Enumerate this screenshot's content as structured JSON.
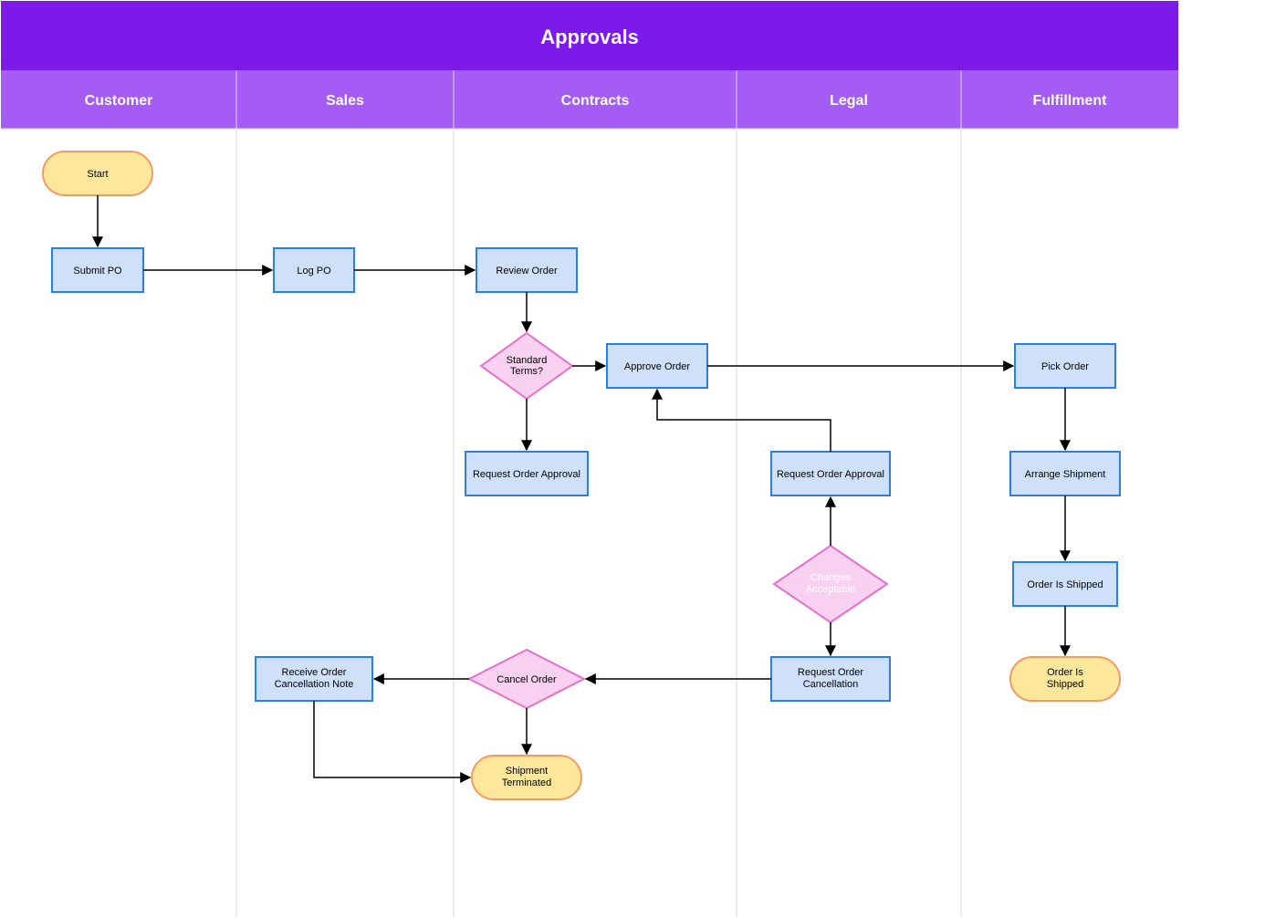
{
  "diagram": {
    "type": "swimlane-flowchart",
    "title": "Approvals",
    "lanes": [
      {
        "id": "customer",
        "label": "Customer"
      },
      {
        "id": "sales",
        "label": "Sales"
      },
      {
        "id": "contracts",
        "label": "Contracts"
      },
      {
        "id": "legal",
        "label": "Legal"
      },
      {
        "id": "fulfillment",
        "label": "Fulfillment"
      }
    ],
    "nodes": {
      "start": {
        "lane": "customer",
        "type": "terminator",
        "label": "Start"
      },
      "submit_po": {
        "lane": "customer",
        "type": "process",
        "label": "Submit PO"
      },
      "log_po": {
        "lane": "sales",
        "type": "process",
        "label": "Log PO"
      },
      "review_order": {
        "lane": "contracts",
        "type": "process",
        "label": "Review Order"
      },
      "standard_terms": {
        "lane": "contracts",
        "type": "decision",
        "label": "Standard Terms?"
      },
      "request_approval_contracts": {
        "lane": "contracts",
        "type": "process",
        "label": "Request Order Approval"
      },
      "approve_order": {
        "lane": "contracts",
        "type": "process",
        "label": "Approve Order"
      },
      "request_approval_legal": {
        "lane": "legal",
        "type": "process",
        "label": "Request Order Approval"
      },
      "changes_acceptable": {
        "lane": "legal",
        "type": "decision",
        "label": "Changes Acceptable"
      },
      "request_cancellation_legal": {
        "lane": "legal",
        "type": "process",
        "label": "Request Order Cancellation"
      },
      "cancel_order": {
        "lane": "contracts",
        "type": "decision",
        "label": "Cancel Order"
      },
      "receive_cancel_note": {
        "lane": "sales",
        "type": "process",
        "label": "Receive Order Cancellation Note"
      },
      "shipment_terminated": {
        "lane": "contracts",
        "type": "terminator",
        "label": "Shipment Terminated"
      },
      "pick_order": {
        "lane": "fulfillment",
        "type": "process",
        "label": "Pick Order"
      },
      "arrange_shipment": {
        "lane": "fulfillment",
        "type": "process",
        "label": "Arrange Shipment"
      },
      "order_shipped": {
        "lane": "fulfillment",
        "type": "process",
        "label": "Order Is Shipped"
      },
      "order_shipped_end": {
        "lane": "fulfillment",
        "type": "terminator",
        "label": "Order Is Shipped"
      }
    },
    "edges": [
      [
        "start",
        "submit_po"
      ],
      [
        "submit_po",
        "log_po"
      ],
      [
        "log_po",
        "review_order"
      ],
      [
        "review_order",
        "standard_terms"
      ],
      [
        "standard_terms",
        "approve_order"
      ],
      [
        "standard_terms",
        "request_approval_contracts"
      ],
      [
        "approve_order",
        "pick_order"
      ],
      [
        "request_approval_legal",
        "approve_order"
      ],
      [
        "changes_acceptable",
        "request_approval_legal"
      ],
      [
        "changes_acceptable",
        "request_cancellation_legal"
      ],
      [
        "request_cancellation_legal",
        "cancel_order"
      ],
      [
        "cancel_order",
        "receive_cancel_note"
      ],
      [
        "cancel_order",
        "shipment_terminated"
      ],
      [
        "receive_cancel_note",
        "shipment_terminated"
      ],
      [
        "pick_order",
        "arrange_shipment"
      ],
      [
        "arrange_shipment",
        "order_shipped"
      ],
      [
        "order_shipped",
        "order_shipped_end"
      ]
    ]
  },
  "colors": {
    "header_bg": "#7c1aea",
    "lane_bg": "#a45cf4",
    "lane_divider": "#d9d9d9",
    "process_fill": "#cfe0fb",
    "process_stroke": "#2b7de9",
    "decision_fill": "#f7d1ef",
    "decision_stroke": "#e66fc9",
    "terminator_fill": "#fde79a",
    "terminator_stroke": "#f39a63",
    "arrow": "#000000"
  }
}
